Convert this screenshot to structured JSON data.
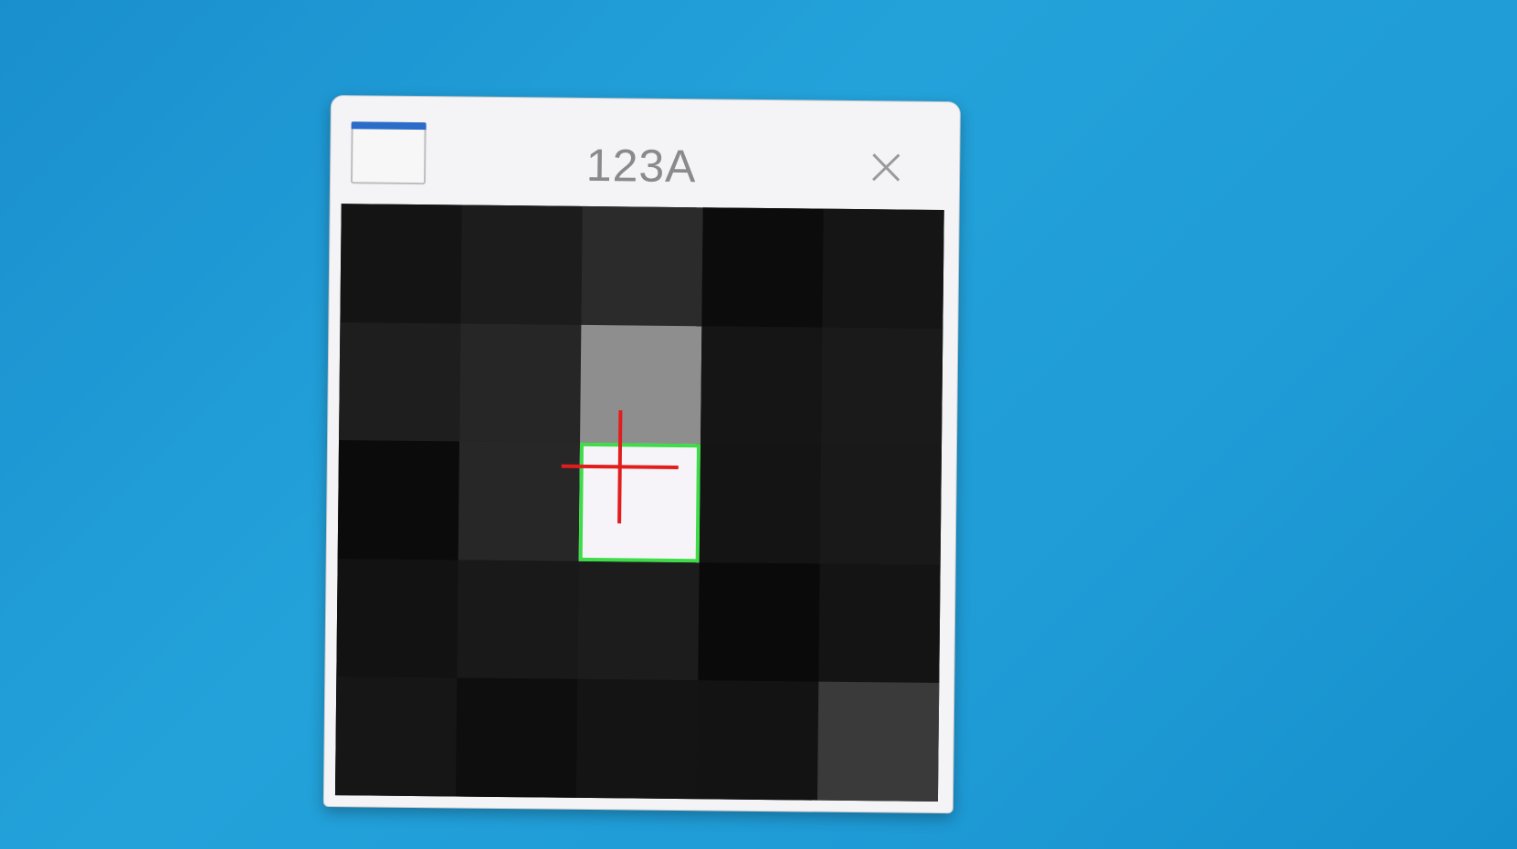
{
  "window": {
    "title": "123A",
    "icon": "window-app-icon",
    "close_icon": "close-icon",
    "accent_color": "#2b6cc9"
  },
  "canvas": {
    "description_type": "pixel-grid",
    "rows": 5,
    "cols": 5,
    "cells": [
      [
        "#141414",
        "#1c1c1c",
        "#2b2b2b",
        "#0c0c0c",
        "#151515"
      ],
      [
        "#1e1e1e",
        "#262626",
        "#8e8e8e",
        "#151515",
        "#1a1a1a"
      ],
      [
        "#0b0b0b",
        "#272727",
        "#f6f4f8",
        "#141414",
        "#191919"
      ],
      [
        "#121212",
        "#191919",
        "#1c1c1c",
        "#0a0a0a",
        "#141414"
      ],
      [
        "#161616",
        "#0e0e0e",
        "#141414",
        "#131313",
        "#3a3a3a"
      ]
    ],
    "selected_cell": {
      "row": 2,
      "col": 2
    },
    "selection_color": "#3fdc4a",
    "crosshair_color": "#e21d1d",
    "crosshair_icon": "crosshair-icon"
  }
}
